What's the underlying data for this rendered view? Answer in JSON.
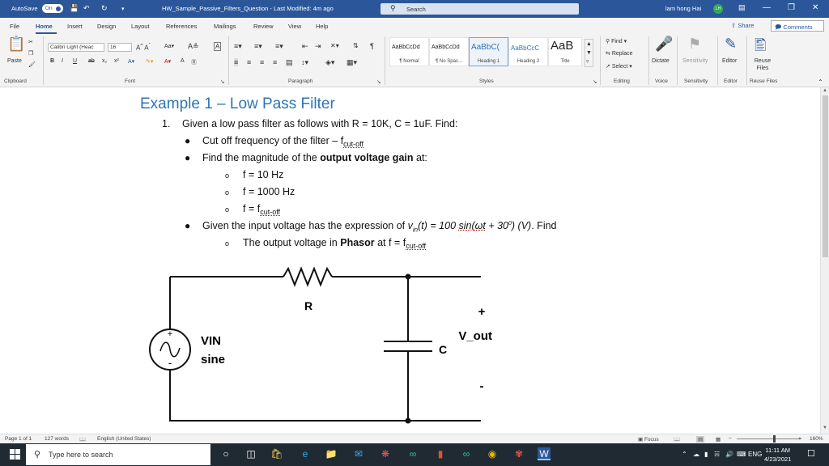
{
  "titlebar": {
    "autosave": "AutoSave",
    "toggle": "On",
    "doc_title": "HW_Sample_Passive_Filters_Question  -  Last Modified: 4m ago",
    "search": "Search",
    "user": "lam hong Hai",
    "initials": "LH"
  },
  "tabs": [
    "File",
    "Home",
    "Insert",
    "Design",
    "Layout",
    "References",
    "Mailings",
    "Review",
    "View",
    "Help"
  ],
  "share": "Share",
  "comments": "Comments",
  "ribbon": {
    "clipboard": {
      "paste": "Paste",
      "label": "Clipboard"
    },
    "font": {
      "name": "Calibri Light (Heac",
      "size": "16",
      "label": "Font"
    },
    "paragraph": {
      "label": "Paragraph"
    },
    "styles": {
      "label": "Styles",
      "items": [
        {
          "preview": "AaBbCcDd",
          "name": "¶ Normal"
        },
        {
          "preview": "AaBbCcDd",
          "name": "¶ No Spac..."
        },
        {
          "preview": "AaBbC(",
          "name": "Heading 1"
        },
        {
          "preview": "AaBbCcC",
          "name": "Heading 2"
        },
        {
          "preview": "AaB",
          "name": "Title"
        }
      ]
    },
    "editing": {
      "find": "Find",
      "replace": "Replace",
      "select": "Select",
      "label": "Editing"
    },
    "dictate": "Dictate",
    "voice": "Voice",
    "sensitivity": "Sensitivity",
    "editor": "Editor",
    "reuse": "Reuse Files",
    "reuse_label": "Reuse Files"
  },
  "document": {
    "heading": "Example 1 – Low Pass Filter",
    "item1_num": "1.",
    "item1": "Given a low pass filter as follows with R = 10K, C = 1uF. Find:",
    "b1a": "Cut off frequency of the filter – f",
    "b1a_sub": "cut-off",
    "b2_pre": "Find the magnitude of the ",
    "b2_bold": "output voltage gain",
    "b2_post": " at:",
    "s1": "f = 10 Hz",
    "s2": "f = 1000 Hz",
    "s3": "f = f",
    "s3_sub": "cut-off",
    "b3_pre": "Given the input voltage has the expression of ",
    "b3_v": "v",
    "b3_v_sub": "in",
    "b3_expr": "(t) = 100 ",
    "b3_sin": "sin(ωt",
    "b3_rest": " + 30",
    "b3_deg": "0",
    "b3_end": ") (V)",
    "b3_find": ". Find",
    "s4_pre": "The output voltage in ",
    "s4_bold": "Phasor",
    "s4_mid": " at f = f",
    "s4_sub": "cut-off"
  },
  "circuit": {
    "r_label": "R",
    "c_label": "C",
    "vin": "VIN",
    "sine": "sine",
    "vout": "V_out",
    "plus": "+",
    "minus": "-",
    "src_plus": "+"
  },
  "status": {
    "page": "Page 1 of 1",
    "words": "127 words",
    "lang": "English (United States)",
    "focus": "Focus",
    "zoom": "160%"
  },
  "taskbar": {
    "search": "Type here to search",
    "lang": "ENG",
    "time": "11:11 AM",
    "date": "4/23/2021"
  }
}
